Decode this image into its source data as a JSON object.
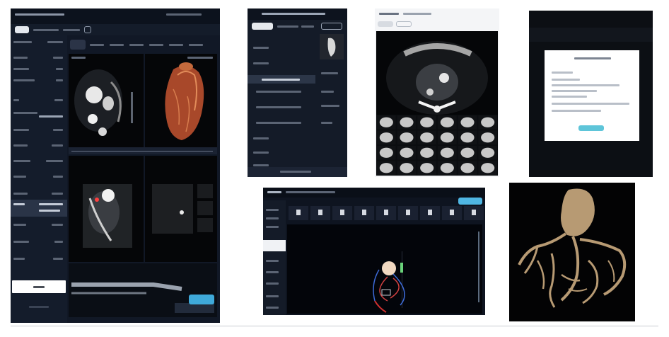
{
  "panel1": {
    "bottom_button_label": "",
    "bottom_button_color": "#ffffff",
    "accent": "#3fa9d9"
  },
  "panel2": {
    "accent": "#e6e9ee"
  },
  "panel4": {
    "dialog_button_color": "#5ec5d9"
  },
  "panel5": {
    "accent": "#4fb6e3"
  },
  "colors": {
    "panel_bg": "#0f1624",
    "vessel": "#b79a73"
  }
}
